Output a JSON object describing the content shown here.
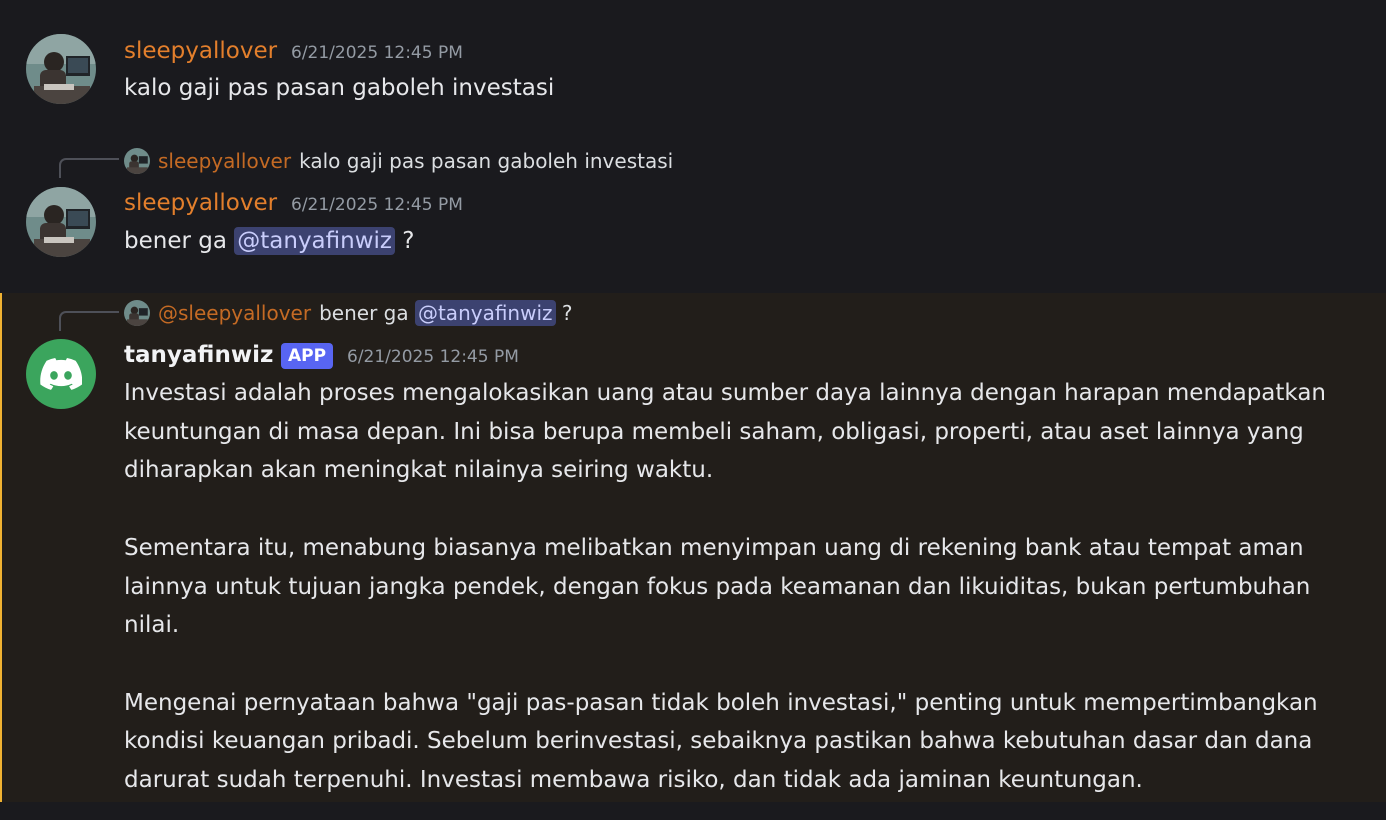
{
  "messages": [
    {
      "username": "sleepyallover",
      "timestamp": "6/21/2025 12:45 PM",
      "text": "kalo gaji pas pasan gaboleh investasi"
    },
    {
      "reply": {
        "username": "sleepyallover",
        "text": "kalo gaji pas pasan gaboleh investasi"
      },
      "username": "sleepyallover",
      "timestamp": "6/21/2025 12:45 PM",
      "text_before": "bener ga ",
      "mention": "@tanyafinwiz",
      "text_after": " ?"
    },
    {
      "reply": {
        "username": "@sleepyallover",
        "text_before": "bener ga ",
        "mention": "@tanyafinwiz",
        "text_after": " ?"
      },
      "username": "tanyafinwiz",
      "badge": "APP",
      "timestamp": "6/21/2025 12:45 PM",
      "paragraphs": [
        [
          "Investasi adalah proses mengalokasikan uang atau sumber daya lainnya dengan harapan mendapatkan",
          "keuntungan di masa depan. Ini bisa berupa membeli saham, obligasi, properti, atau aset lainnya yang",
          "diharapkan akan meningkat nilainya seiring waktu."
        ],
        [
          "Sementara itu, menabung biasanya melibatkan menyimpan uang di rekening bank atau tempat aman",
          "lainnya untuk tujuan jangka pendek, dengan fokus pada keamanan dan likuiditas, bukan pertumbuhan",
          "nilai."
        ],
        [
          "Mengenai pernyataan bahwa \"gaji pas-pasan tidak boleh investasi,\" penting untuk mempertimbangkan",
          "kondisi keuangan pribadi. Sebelum berinvestasi, sebaiknya pastikan bahwa kebutuhan dasar dan dana",
          "darurat sudah terpenuhi. Investasi membawa risiko, dan tidak ada jaminan keuntungan."
        ]
      ]
    }
  ],
  "colors": {
    "background": "#1a1a1e",
    "highlight_background": "#221e1a",
    "highlight_border": "#f0b232",
    "username_orange": "#e37f2c",
    "mention_bg": "#3c4270",
    "mention_text": "#c9cdfb",
    "app_badge": "#5865f2",
    "bot_avatar": "#3ba55d"
  },
  "icons": {
    "user_avatar": "user-photo-avatar",
    "bot_avatar": "discord-logo-icon"
  }
}
